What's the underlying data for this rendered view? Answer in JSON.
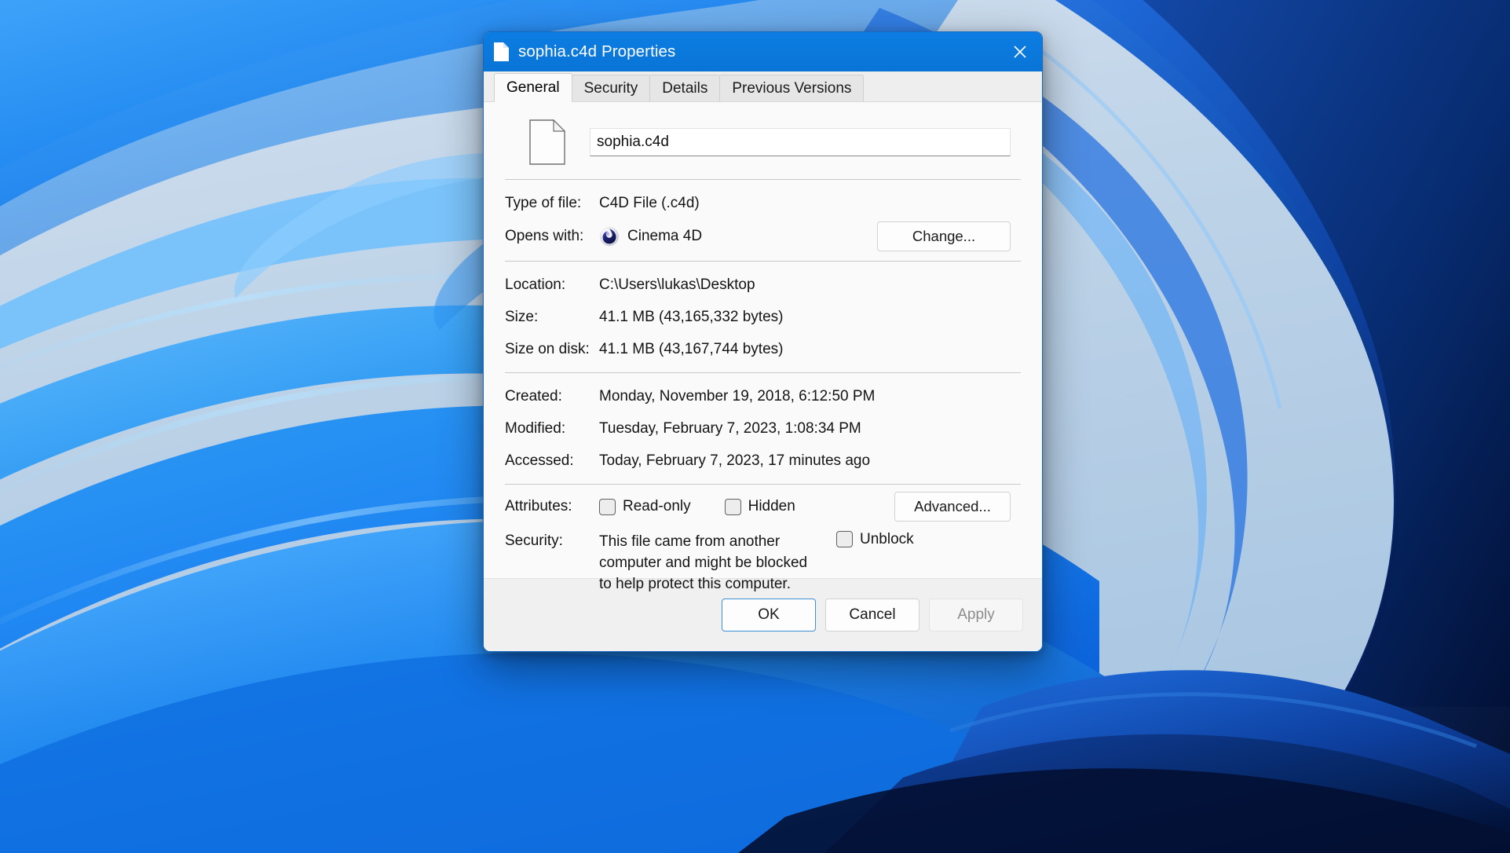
{
  "window": {
    "title": "sophia.c4d Properties",
    "icon": "file-document-icon",
    "close_label": "Close"
  },
  "tabs": [
    {
      "label": "General",
      "active": true
    },
    {
      "label": "Security",
      "active": false
    },
    {
      "label": "Details",
      "active": false
    },
    {
      "label": "Previous Versions",
      "active": false
    }
  ],
  "general": {
    "filename": "sophia.c4d",
    "file_icon": "blank-document-icon",
    "type_label": "Type of file:",
    "type_value": "C4D File (.c4d)",
    "opens_with_label": "Opens with:",
    "opens_with_app": "Cinema 4D",
    "opens_with_app_icon": "cinema4d-icon",
    "change_button": "Change...",
    "location_label": "Location:",
    "location_value": "C:\\Users\\lukas\\Desktop",
    "size_label": "Size:",
    "size_value": "41.1 MB (43,165,332 bytes)",
    "size_on_disk_label": "Size on disk:",
    "size_on_disk_value": "41.1 MB (43,167,744 bytes)",
    "created_label": "Created:",
    "created_value": "Monday, November 19, 2018, 6:12:50 PM",
    "modified_label": "Modified:",
    "modified_value": "Tuesday, February 7, 2023, 1:08:34 PM",
    "accessed_label": "Accessed:",
    "accessed_value": "Today, February 7, 2023, 17 minutes ago",
    "attributes_label": "Attributes:",
    "readonly_label": "Read-only",
    "readonly_checked": false,
    "hidden_label": "Hidden",
    "hidden_checked": false,
    "advanced_button": "Advanced...",
    "security_label": "Security:",
    "security_text": "This file came from another computer and might be blocked to help protect this computer.",
    "unblock_label": "Unblock",
    "unblock_checked": false
  },
  "footer": {
    "ok": "OK",
    "cancel": "Cancel",
    "apply": "Apply",
    "apply_disabled": true
  },
  "colors": {
    "titlebar": "#0a7ae0",
    "accent": "#3f8fd4",
    "content_bg": "#fafafa",
    "footer_bg": "#f0f0f0",
    "text": "#141414",
    "disabled_text": "#8c8c8c"
  }
}
